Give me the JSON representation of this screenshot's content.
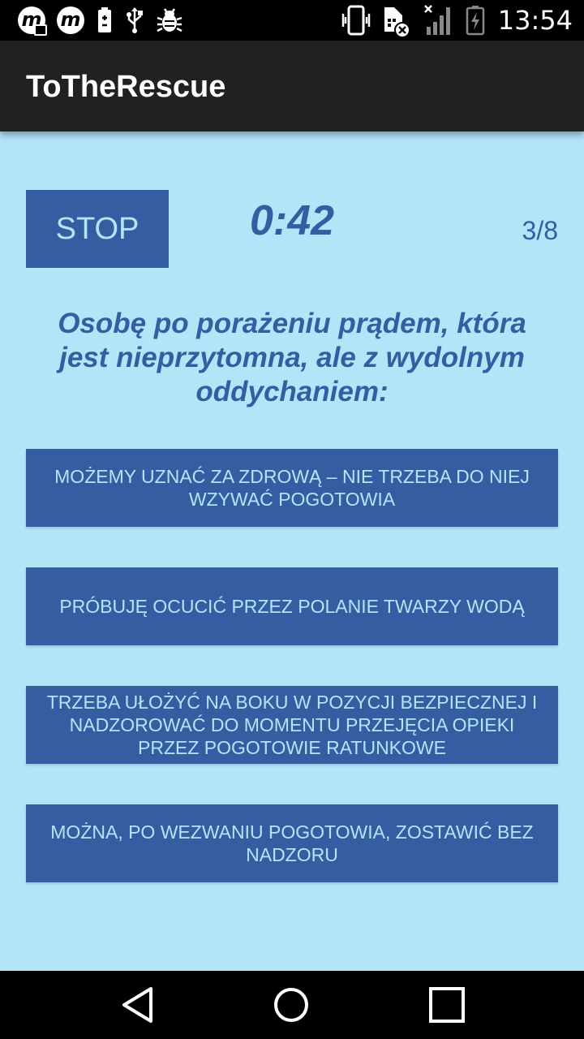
{
  "status_bar": {
    "time": "13:54",
    "left_icons": [
      "mobile-m-camera-icon",
      "mobile-m-icon",
      "battery-saver-icon",
      "usb-icon",
      "bug-icon"
    ],
    "right_icons": [
      "vibrate-icon",
      "sim-error-icon",
      "signal-icon",
      "battery-charging-icon"
    ],
    "app_icon_letter": "m"
  },
  "app_bar": {
    "title": "ToTheRescue"
  },
  "quiz": {
    "stop_label": "STOP",
    "timer": "0:42",
    "progress": "3/8",
    "question": "Osobę po porażeniu prądem, która jest nieprzytomna, ale z wydolnym oddychaniem:",
    "answers": [
      "MOŻEMY UZNAĆ ZA ZDROWĄ – NIE TRZEBA DO NIEJ WZYWAĆ POGOTOWIA",
      "PRÓBUJĘ OCUCIĆ PRZEZ POLANIE TWARZY WODĄ",
      "TRZEBA UŁOŻYĆ NA BOKU W POZYCJI BEZPIECZNEJ I NADZOROWAĆ DO MOMENTU PRZEJĘCIA OPIEKI PRZEZ POGOTOWIE RATUNKOWE",
      "MOŻNA, PO WEZWANIU POGOTOWIA, ZOSTAWIĆ BEZ NADZORU"
    ]
  },
  "nav_bar": {
    "icons": [
      "back-icon",
      "home-icon",
      "recents-icon"
    ]
  },
  "colors": {
    "background": "#b3e5f8",
    "accent": "#345da2",
    "app_bar": "#212121",
    "system_bar": "#000000"
  }
}
